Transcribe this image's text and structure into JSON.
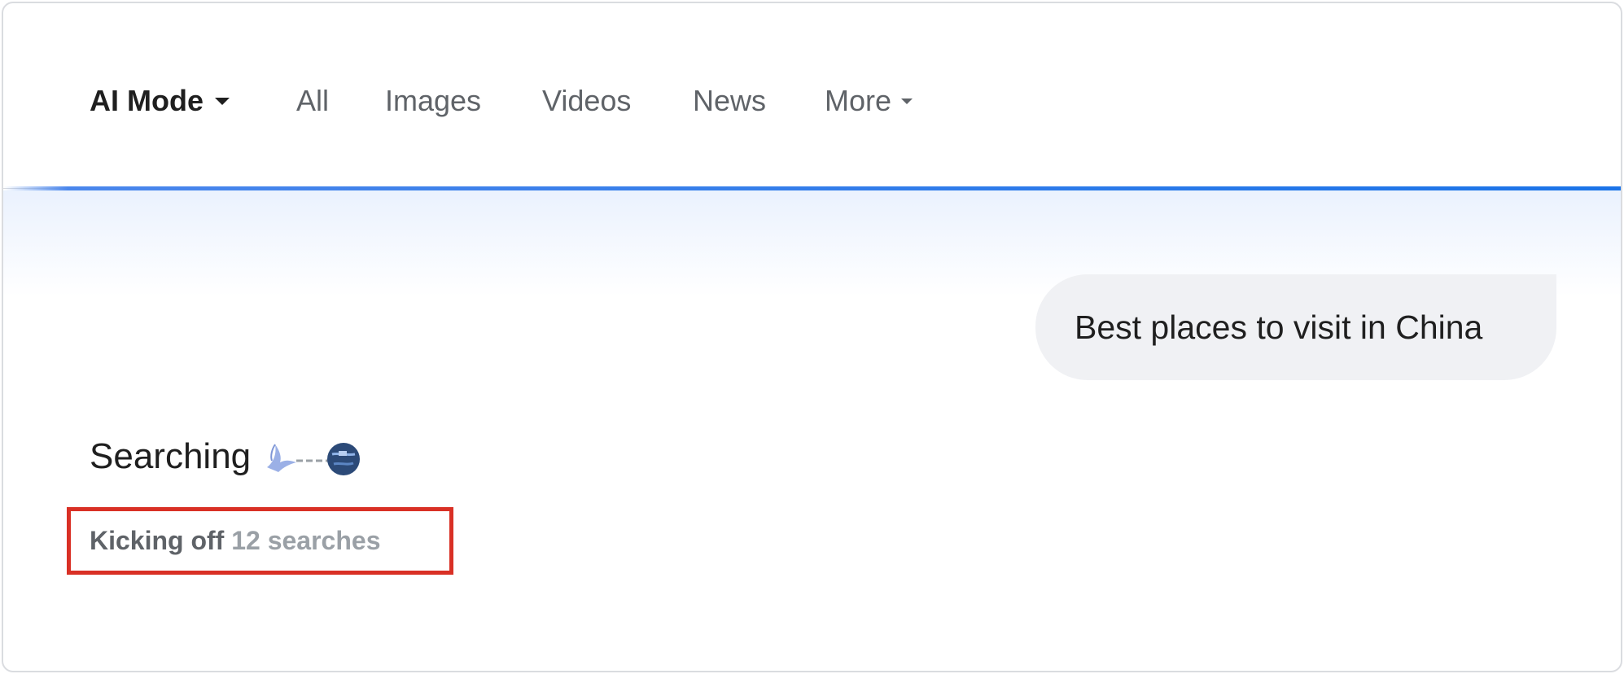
{
  "tabs": [
    {
      "label": "AI Mode",
      "active": true,
      "has_dropdown": true
    },
    {
      "label": "All",
      "active": false
    },
    {
      "label": "Images",
      "active": false
    },
    {
      "label": "Videos",
      "active": false
    },
    {
      "label": "News",
      "active": false
    },
    {
      "label": "More",
      "active": false,
      "has_dropdown": true
    }
  ],
  "query": "Best places to visit in China",
  "status": {
    "label": "Searching",
    "animation_icon": "searching-animation-icon",
    "kick_prefix": "Kicking off",
    "kick_count": "12 searches"
  },
  "colors": {
    "accent_blue": "#1a73e8",
    "highlight_red": "#d93025",
    "bubble_bg": "#f0f1f4"
  }
}
